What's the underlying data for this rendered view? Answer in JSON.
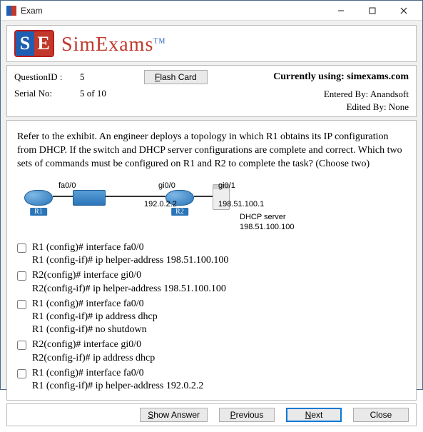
{
  "window": {
    "title": "Exam"
  },
  "logo": {
    "s": "S",
    "e": "E",
    "text": "SimExams",
    "tm": "TM"
  },
  "info": {
    "qid_label": "QuestionID :",
    "qid_value": "5",
    "flash_label": "Flash Card",
    "using_label": "Currently using: simexams.com",
    "serial_label": "Serial No:",
    "serial_value": "5 of 10",
    "entered_by": "Entered By: Anandsoft",
    "edited_by": "Edited By: None"
  },
  "question": "Refer to the exhibit. An engineer deploys a topology in which R1 obtains its IP configuration from DHCP. If the switch and DHCP server configurations are complete and correct. Which two sets of commands must be configured on R1 and R2 to complete the task? (Choose two)",
  "diagram": {
    "r1": "R1",
    "r2": "R2",
    "if_fa00": "fa0/0",
    "if_gi00": "gi0/0",
    "if_gi01": "gi0/1",
    "ip1": "192.0.2.2",
    "ip2": "198.51.100.1",
    "server_lbl": "DHCP server",
    "server_ip": "198.51.100.100"
  },
  "answers": [
    "R1 (config)# interface fa0/0\nR1 (config-if)# ip helper-address 198.51.100.100",
    "R2(config)# interface gi0/0\nR2(config-if)# ip helper-address 198.51.100.100",
    " R1 (config)# interface fa0/0\nR1 (config-if)# ip address dhcp\nR1 (config-if)# no shutdown",
    "R2(config)# interface gi0/0\nR2(config-if)# ip address dhcp",
    "R1 (config)# interface fa0/0\nR1 (config-if)# ip helper-address 192.0.2.2"
  ],
  "buttons": {
    "show": "Show Answer",
    "prev": "Previous",
    "next": "Next",
    "close": "Close"
  }
}
